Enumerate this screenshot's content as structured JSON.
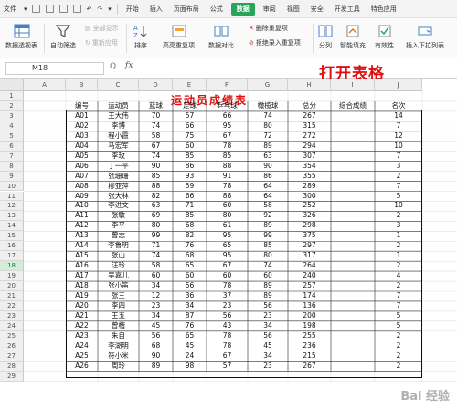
{
  "menubar": {
    "file_label": "文件",
    "tabs": [
      "开始",
      "插入",
      "页面布局",
      "公式",
      "数据",
      "审阅",
      "视图",
      "安全",
      "开发工具",
      "特色应用"
    ],
    "active_tab": "数据"
  },
  "ribbon": {
    "pivot_label": "数据透视表",
    "autofilter_label": "自动筛选",
    "show_all_label": "全部显示",
    "reapply_label": "重新应用",
    "sort_label": "排序",
    "highlight_dup_label": "高亮重复项",
    "data_compare_label": "数据对比",
    "delete_dup_label": "删除重复项",
    "reject_dup_label": "拒绝录入重复项",
    "split_label": "分列",
    "smart_fill_label": "智能填充",
    "validity_label": "有效性",
    "dropdown_label": "插入下拉列表"
  },
  "formula_bar": {
    "name_box": "M18",
    "fx_label": "fx",
    "zoom_glyph": "Q"
  },
  "overlay_text": "打开表格",
  "watermark": "Bai 经验",
  "sheet": {
    "columns": [
      "A",
      "B",
      "C",
      "D",
      "E",
      "F",
      "G",
      "H",
      "I",
      "J"
    ],
    "row_numbers": [
      1,
      2,
      3,
      4,
      5,
      6,
      7,
      8,
      9,
      10,
      11,
      12,
      13,
      14,
      15,
      16,
      17,
      18,
      19,
      20,
      21,
      22,
      23,
      24,
      25,
      26,
      27,
      28,
      29
    ],
    "selected_row": 18,
    "title": "运动员成绩表",
    "headers": [
      "编号",
      "运动员",
      "篮球",
      "足球",
      "乒乓球",
      "橄榄球",
      "总分",
      "综合成绩",
      "名次"
    ],
    "rows": [
      [
        "A01",
        "王大伟",
        "70",
        "57",
        "66",
        "74",
        "267",
        "",
        "14"
      ],
      [
        "A02",
        "李博",
        "74",
        "66",
        "95",
        "80",
        "315",
        "",
        "7"
      ],
      [
        "A03",
        "程小霞",
        "58",
        "75",
        "67",
        "72",
        "272",
        "",
        "12"
      ],
      [
        "A04",
        "马宏军",
        "67",
        "60",
        "78",
        "89",
        "294",
        "",
        "10"
      ],
      [
        "A05",
        "李玫",
        "74",
        "85",
        "85",
        "63",
        "307",
        "",
        "7"
      ],
      [
        "A06",
        "丁一平",
        "90",
        "86",
        "88",
        "90",
        "354",
        "",
        "3"
      ],
      [
        "A07",
        "张珊珊",
        "85",
        "93",
        "91",
        "86",
        "355",
        "",
        "2"
      ],
      [
        "A08",
        "柳亚萍",
        "88",
        "59",
        "78",
        "64",
        "289",
        "",
        "7"
      ],
      [
        "A09",
        "张大林",
        "82",
        "66",
        "88",
        "64",
        "300",
        "",
        "5"
      ],
      [
        "A10",
        "李进文",
        "63",
        "71",
        "60",
        "58",
        "252",
        "",
        "10"
      ],
      [
        "A11",
        "张敏",
        "69",
        "85",
        "80",
        "92",
        "326",
        "",
        "2"
      ],
      [
        "A12",
        "李平",
        "80",
        "68",
        "61",
        "89",
        "298",
        "",
        "3"
      ],
      [
        "A13",
        "曾志",
        "99",
        "82",
        "95",
        "99",
        "375",
        "",
        "1"
      ],
      [
        "A14",
        "李鲁明",
        "71",
        "76",
        "65",
        "85",
        "297",
        "",
        "2"
      ],
      [
        "A15",
        "张山",
        "74",
        "68",
        "95",
        "80",
        "317",
        "",
        "1"
      ],
      [
        "A16",
        "汪玲",
        "58",
        "65",
        "67",
        "74",
        "264",
        "",
        "2"
      ],
      [
        "A17",
        "吴嘉儿",
        "60",
        "60",
        "60",
        "60",
        "240",
        "",
        "4"
      ],
      [
        "A18",
        "张小笛",
        "34",
        "56",
        "78",
        "89",
        "257",
        "",
        "2"
      ],
      [
        "A19",
        "张三",
        "12",
        "36",
        "37",
        "89",
        "174",
        "",
        "7"
      ],
      [
        "A20",
        "李四",
        "23",
        "34",
        "23",
        "56",
        "136",
        "",
        "7"
      ],
      [
        "A21",
        "王五",
        "34",
        "87",
        "56",
        "23",
        "200",
        "",
        "5"
      ],
      [
        "A22",
        "曾楷",
        "45",
        "76",
        "43",
        "34",
        "198",
        "",
        "5"
      ],
      [
        "A23",
        "朱自",
        "56",
        "65",
        "78",
        "56",
        "255",
        "",
        "2"
      ],
      [
        "A24",
        "李湖明",
        "68",
        "45",
        "78",
        "45",
        "236",
        "",
        "2"
      ],
      [
        "A25",
        "符小米",
        "90",
        "24",
        "67",
        "34",
        "215",
        "",
        "2"
      ],
      [
        "A26",
        "周玲",
        "89",
        "98",
        "57",
        "23",
        "267",
        "",
        "2"
      ]
    ]
  }
}
